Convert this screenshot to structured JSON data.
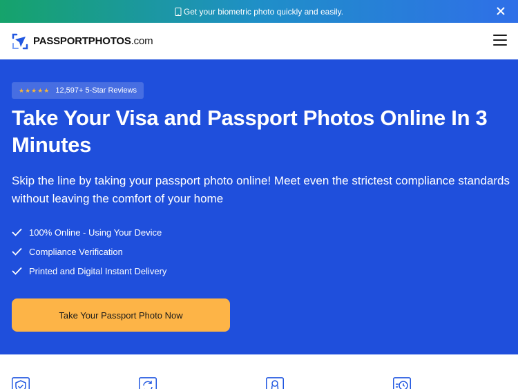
{
  "promo": {
    "text": "Get your biometric photo quickly and easily.",
    "phone_icon": "phone-icon",
    "close_icon": "close-icon"
  },
  "header": {
    "logo_main": "PASSPORTPHOTOS",
    "logo_suffix": ".com",
    "menu_icon": "hamburger-menu-icon"
  },
  "hero": {
    "rating_stars": "★★★★★",
    "reviews_label": "12,597+ 5-Star Reviews",
    "title": "Take Your Visa and Passport Photos Online In 3 Minutes",
    "subtitle": "Skip the line by taking your passport photo online! Meet even the strictest compliance standards without leaving the comfort of your home",
    "features": [
      "100% Online - Using Your Device",
      "Compliance Verification",
      "Printed and Digital Instant Delivery"
    ],
    "cta_label": "Take Your Passport Photo Now"
  },
  "benefits": {
    "icons": [
      "shield-check-icon",
      "refresh-icon",
      "user-badge-icon",
      "clock-icon"
    ]
  },
  "colors": {
    "hero_bg": "#1f4fdc",
    "cta_bg": "#fdb447",
    "promo_gradient_start": "#16a36b",
    "promo_gradient_end": "#2f6fe8",
    "icon_blue": "#2157e0"
  }
}
